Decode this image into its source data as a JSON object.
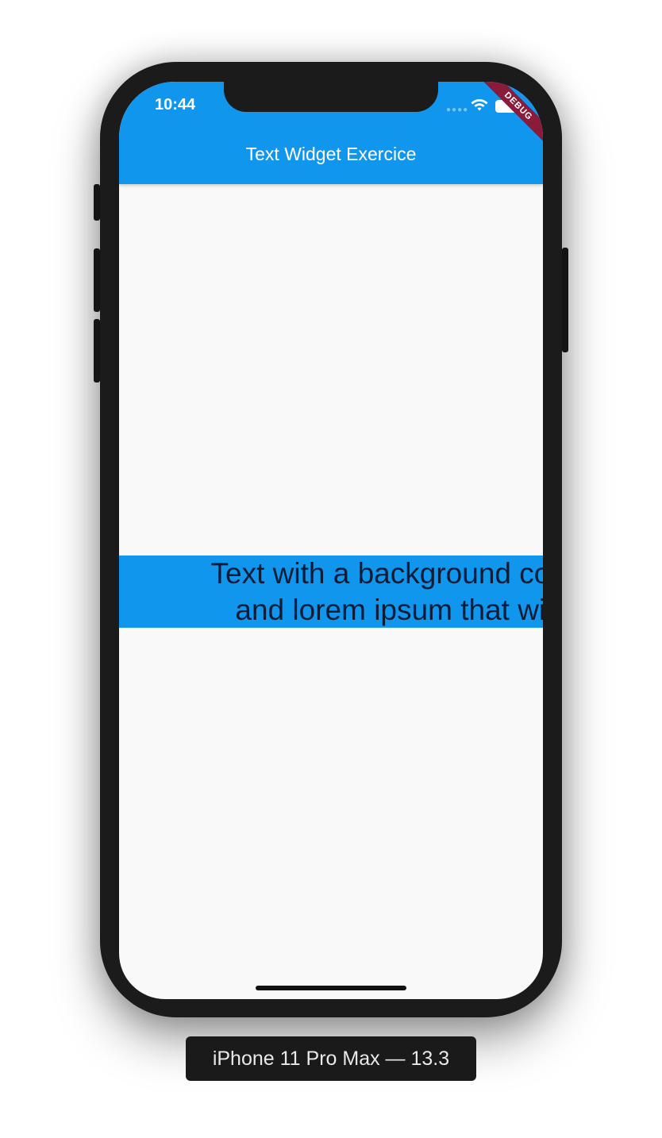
{
  "status_bar": {
    "time": "10:44",
    "icons": [
      "cellular-signal-icon",
      "wifi-icon",
      "battery-icon"
    ]
  },
  "app_bar": {
    "title": "Text Widget Exercice",
    "color": "#1196ee"
  },
  "debug_banner": "DEBUG",
  "body_text": {
    "line1": "Text with a background color",
    "line2": "and lorem ipsum that will",
    "background": "#1196ee",
    "color": "#0f1c36"
  },
  "device_label": "iPhone 11 Pro Max — 13.3"
}
